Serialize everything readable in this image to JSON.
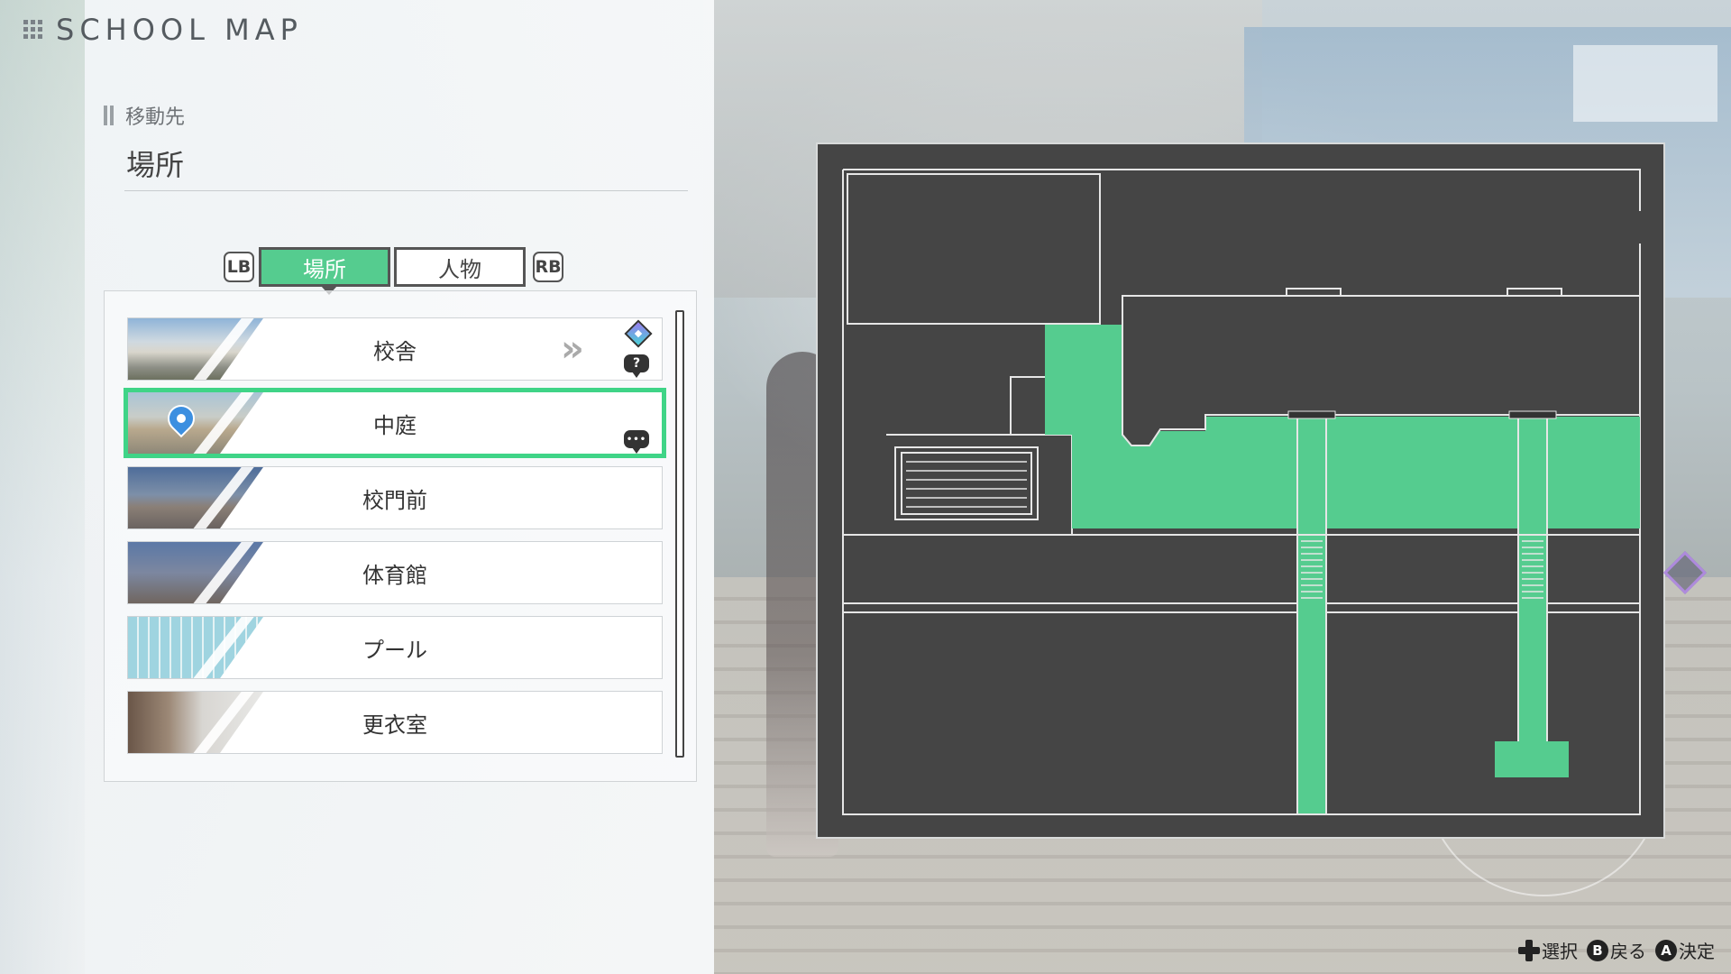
{
  "header": {
    "title": "SCHOOL MAP"
  },
  "section": {
    "label": "移動先",
    "title": "場所"
  },
  "tabs": {
    "lb": "LB",
    "rb": "RB",
    "items": [
      {
        "label": "場所",
        "active": true
      },
      {
        "label": "人物",
        "active": false
      }
    ]
  },
  "locations": [
    {
      "label": "校舎",
      "selected": false,
      "has_next": true,
      "icons": [
        "diamond-marker-icon",
        "question-bubble-icon"
      ]
    },
    {
      "label": "中庭",
      "selected": true,
      "has_next": false,
      "icons": [
        "current-location-pin-icon",
        "chat-bubble-icon"
      ]
    },
    {
      "label": "校門前",
      "selected": false
    },
    {
      "label": "体育館",
      "selected": false
    },
    {
      "label": "プール",
      "selected": false
    },
    {
      "label": "更衣室",
      "selected": false
    }
  ],
  "icon_glyphs": {
    "question": "?",
    "chat": "•••",
    "next": "»"
  },
  "footer_hints": [
    {
      "icon": "dpad-icon",
      "label": "選択"
    },
    {
      "icon": "b-button-icon",
      "button": "B",
      "label": "戻る"
    },
    {
      "icon": "a-button-icon",
      "button": "A",
      "label": "決定"
    }
  ],
  "colors": {
    "accent_green": "#55cc8f",
    "selection_border": "#3fd487",
    "map_background": "#454545",
    "map_highlight": "#55cc8f",
    "pin_blue": "#3c8fe0"
  }
}
